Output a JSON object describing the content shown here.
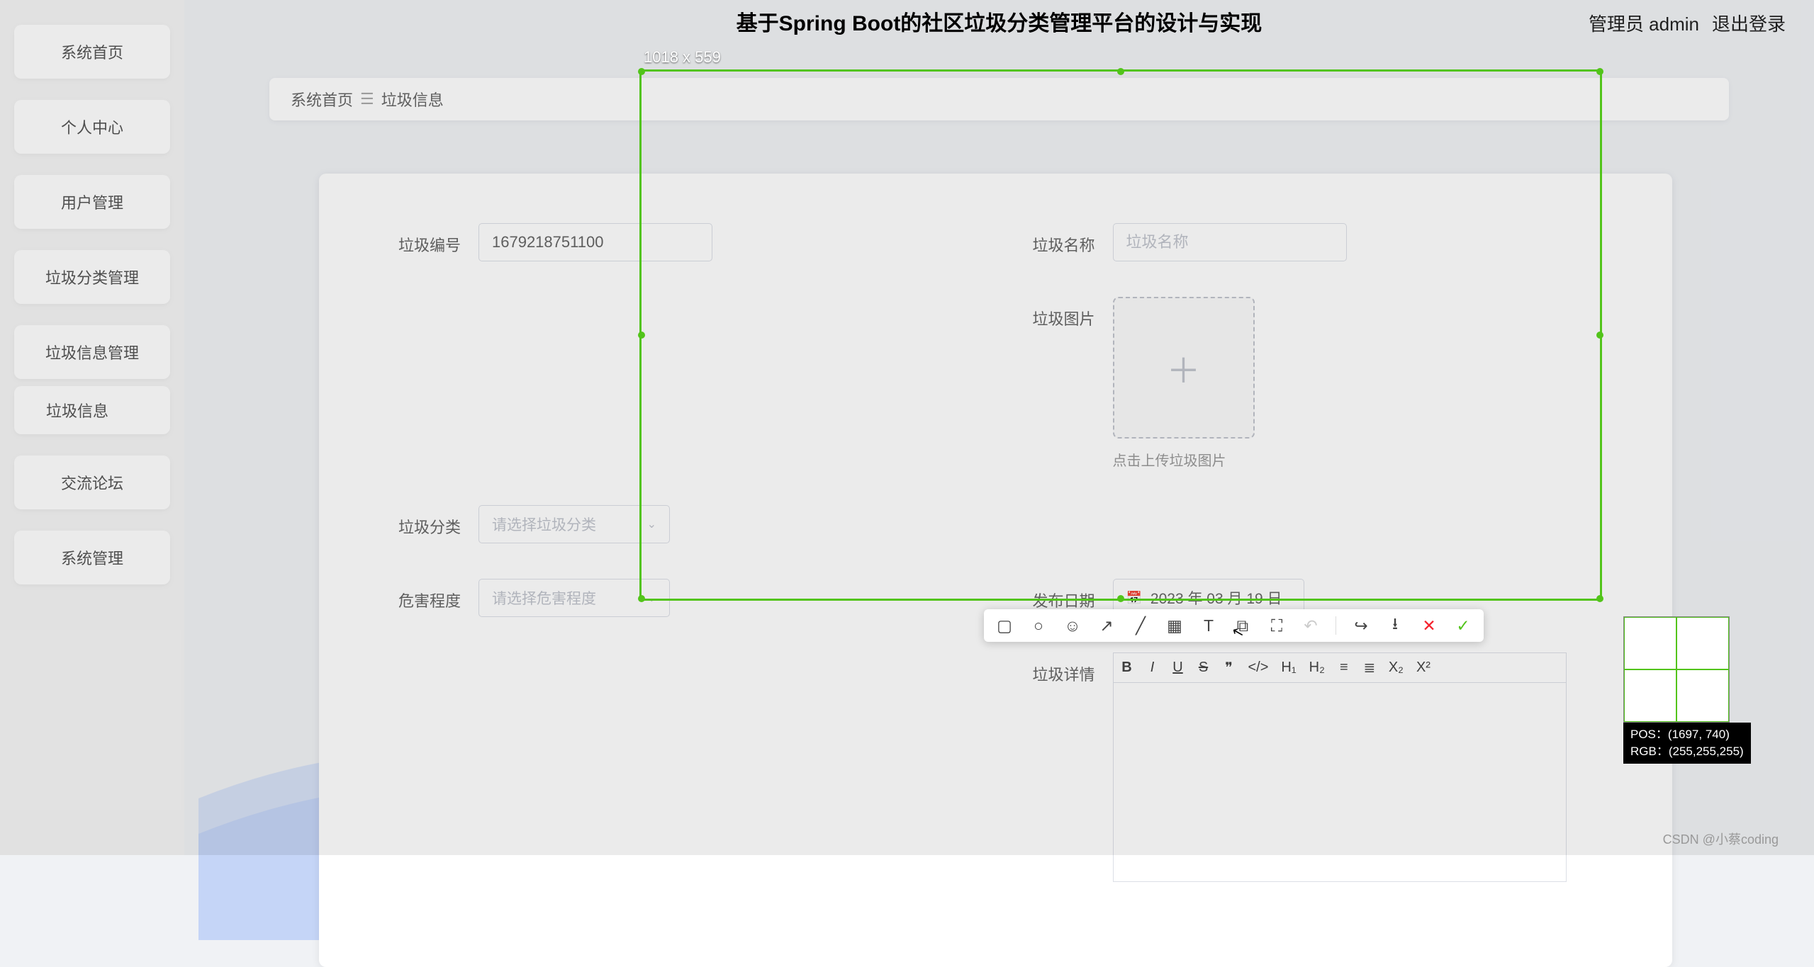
{
  "header": {
    "title": "基于Spring Boot的社区垃圾分类管理平台的设计与实现",
    "admin_label": "管理员 admin",
    "logout_label": "退出登录"
  },
  "sidebar": {
    "items": [
      {
        "label": "系统首页"
      },
      {
        "label": "个人中心"
      },
      {
        "label": "用户管理"
      },
      {
        "label": "垃圾分类管理"
      },
      {
        "label": "垃圾信息管理"
      },
      {
        "label": "交流论坛"
      },
      {
        "label": "系统管理"
      }
    ],
    "subitem_label": "垃圾信息"
  },
  "breadcrumb": {
    "home": "系统首页",
    "current": "垃圾信息"
  },
  "form": {
    "id_label": "垃圾编号",
    "id_value": "1679218751100",
    "name_label": "垃圾名称",
    "name_placeholder": "垃圾名称",
    "image_label": "垃圾图片",
    "upload_hint": "点击上传垃圾图片",
    "category_label": "垃圾分类",
    "category_placeholder": "请选择垃圾分类",
    "danger_label": "危害程度",
    "danger_placeholder": "请选择危害程度",
    "date_label": "发布日期",
    "date_value": "2023 年 03 月 19 日",
    "detail_label": "垃圾详情"
  },
  "editor_tools": {
    "bold": "B",
    "italic": "I",
    "underline": "U",
    "strike": "S",
    "quote": "❞",
    "code": "</>",
    "h1": "H₁",
    "h2": "H₂",
    "ol": "≡",
    "ul": "≣",
    "sub": "X₂",
    "sup": "X²"
  },
  "screenshot": {
    "dimensions": "1018 x 559",
    "pos_label": "POS：",
    "pos_value": "(1697, 740)",
    "rgb_label": "RGB：",
    "rgb_value": "(255,255,255)"
  },
  "watermark": "CSDN @小蔡coding"
}
